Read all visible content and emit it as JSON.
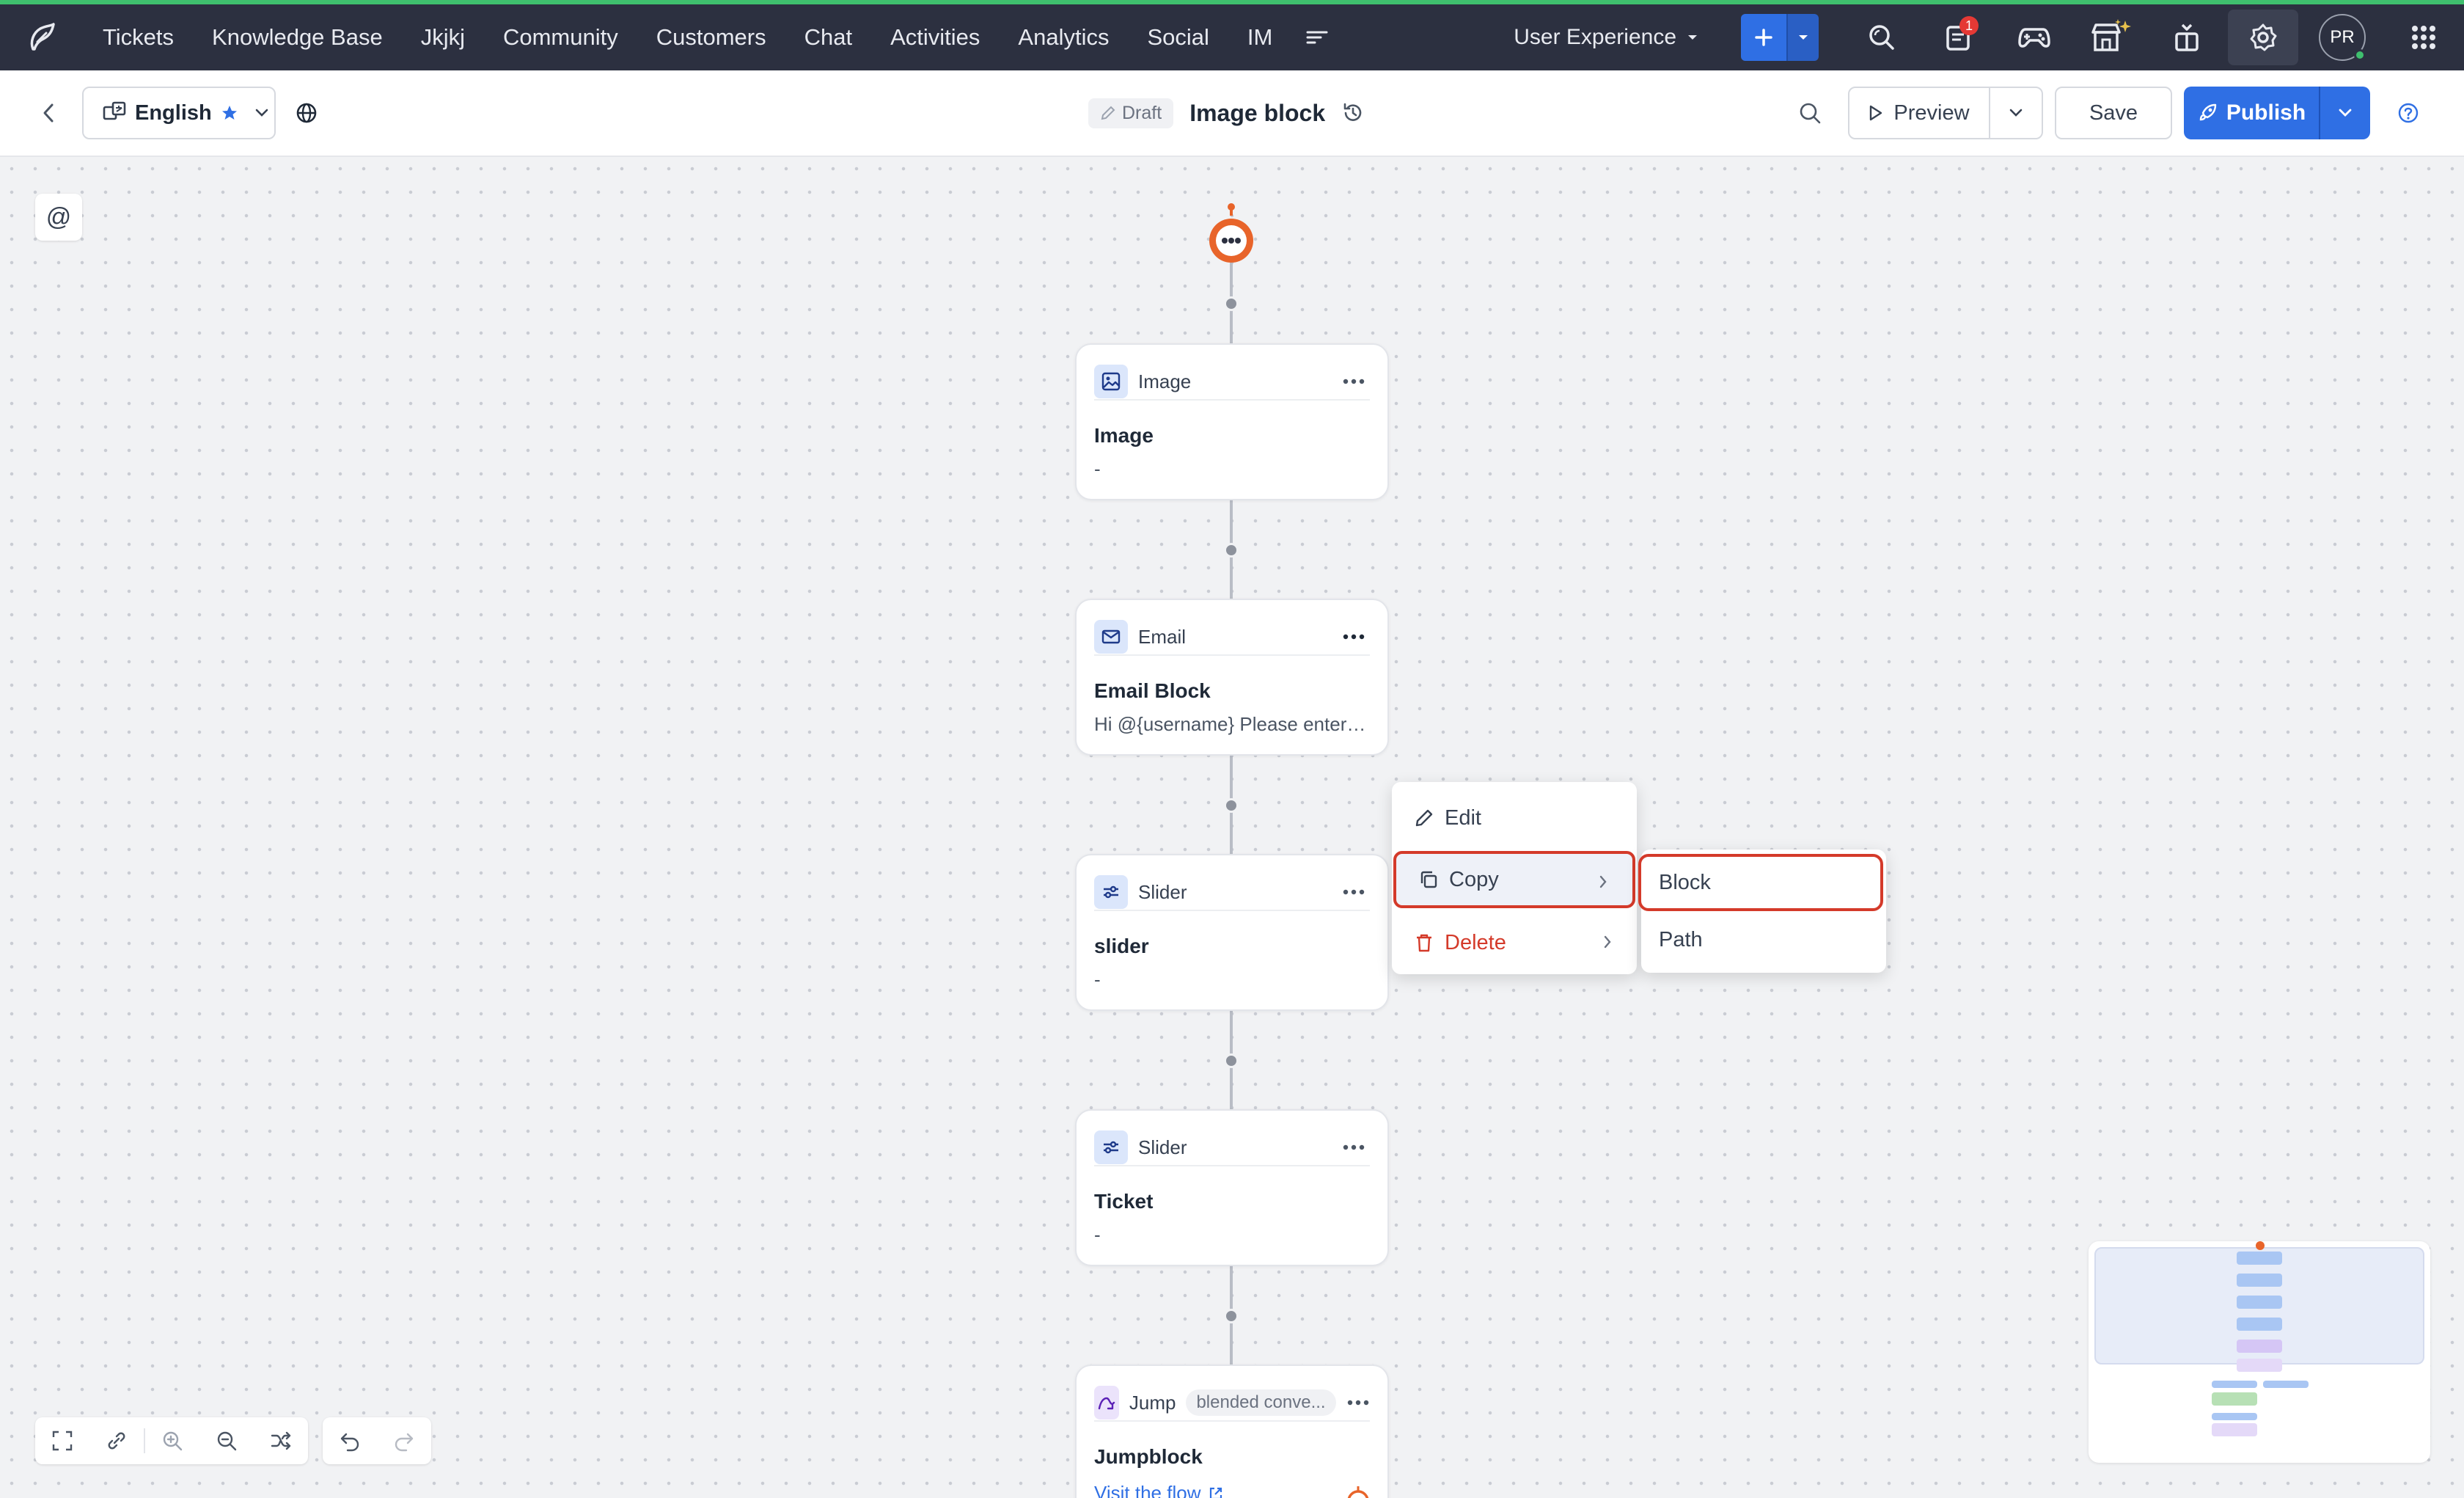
{
  "topnav": {
    "items": [
      "Tickets",
      "Knowledge Base",
      "Jkjkj",
      "Community",
      "Customers",
      "Chat",
      "Activities",
      "Analytics",
      "Social",
      "IM"
    ],
    "department": "User Experience",
    "notification_count": "1",
    "avatar_initials": "PR"
  },
  "toolbar": {
    "language": "English",
    "status": "Draft",
    "title": "Image block",
    "preview_label": "Preview",
    "save_label": "Save",
    "publish_label": "Publish"
  },
  "canvas": {
    "mention_symbol": "@",
    "blocks": [
      {
        "type": "Image",
        "name": "Image",
        "desc": "-"
      },
      {
        "type": "Email",
        "name": "Email Block",
        "desc": "Hi  @{username} Please enter y..."
      },
      {
        "type": "Slider",
        "name": "slider",
        "desc": "-"
      },
      {
        "type": "Slider",
        "name": "Ticket",
        "desc": "-"
      },
      {
        "type": "Jump",
        "tag": "blended conve...",
        "name": "Jumpblock",
        "link": "Visit the flow"
      }
    ]
  },
  "context_menu": {
    "edit": "Edit",
    "copy": "Copy",
    "delete": "Delete",
    "submenu": {
      "block": "Block",
      "path": "Path"
    }
  },
  "colors": {
    "accent": "#2f6fe4",
    "nav_bg": "#2c3040",
    "highlight": "#d43a2a",
    "bot": "#e8642a"
  }
}
